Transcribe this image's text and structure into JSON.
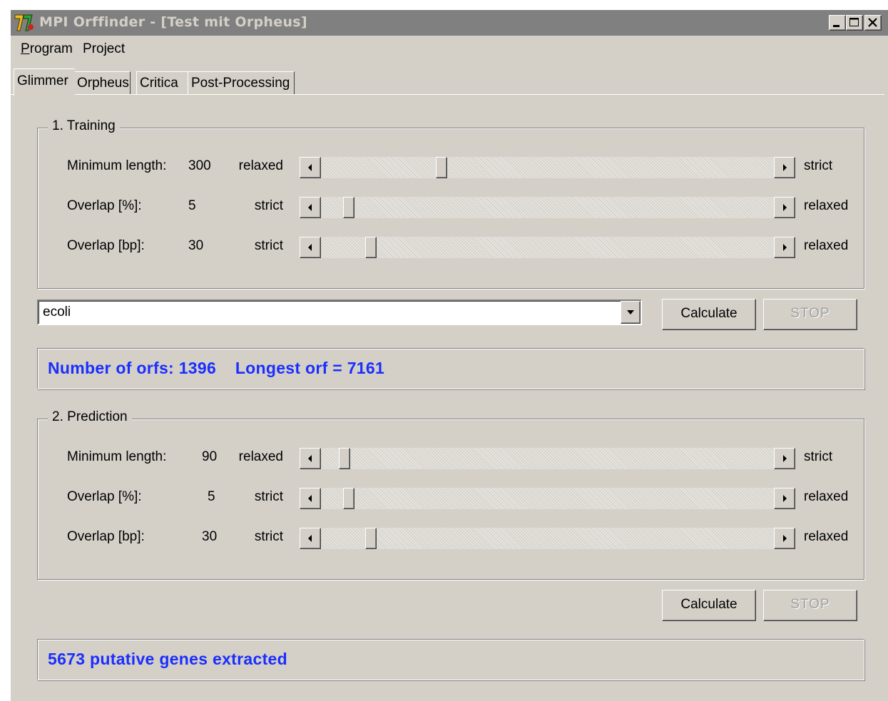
{
  "window": {
    "title": "MPI Orffinder - [Test mit Orpheus]",
    "buttons": [
      "minimize-icon",
      "maximize-icon",
      "close-icon"
    ]
  },
  "menu": [
    {
      "underline": "P",
      "rest": "rogram"
    },
    {
      "underline": "",
      "rest": "Project"
    }
  ],
  "tabs": [
    "Glimmer",
    "Orpheus",
    "Critica",
    "Post-Processing"
  ],
  "active_tab": "Glimmer",
  "training": {
    "title": "1. Training",
    "rows": [
      {
        "label": "Minimum length:",
        "value": "300",
        "left": "relaxed",
        "right": "strict",
        "position": 0.26
      },
      {
        "label": "Overlap [%]:",
        "value": "5",
        "left": "strict",
        "right": "relaxed",
        "position": 0.05
      },
      {
        "label": "Overlap [bp]:",
        "value": "30",
        "left": "strict",
        "right": "relaxed",
        "position": 0.1
      }
    ],
    "organism": "ecoli",
    "calculate_label": "Calculate",
    "stop_label": "STOP",
    "result": "Number of orfs: 1396    Longest orf = 7161"
  },
  "prediction": {
    "title": "2. Prediction",
    "rows": [
      {
        "label": "Minimum length:",
        "value": "90",
        "left": "relaxed",
        "right": "strict",
        "position": 0.04
      },
      {
        "label": "Overlap [%]:",
        "value": "5",
        "left": "strict",
        "right": "relaxed",
        "position": 0.05
      },
      {
        "label": "Overlap [bp]:",
        "value": "30",
        "left": "strict",
        "right": "relaxed",
        "position": 0.1
      }
    ],
    "calculate_label": "Calculate",
    "stop_label": "STOP",
    "result": "5673 putative genes extracted"
  },
  "colors": {
    "result_text": "#1a2eff",
    "face": "#d4d0c8",
    "titlebar_inactive": "#808080"
  }
}
